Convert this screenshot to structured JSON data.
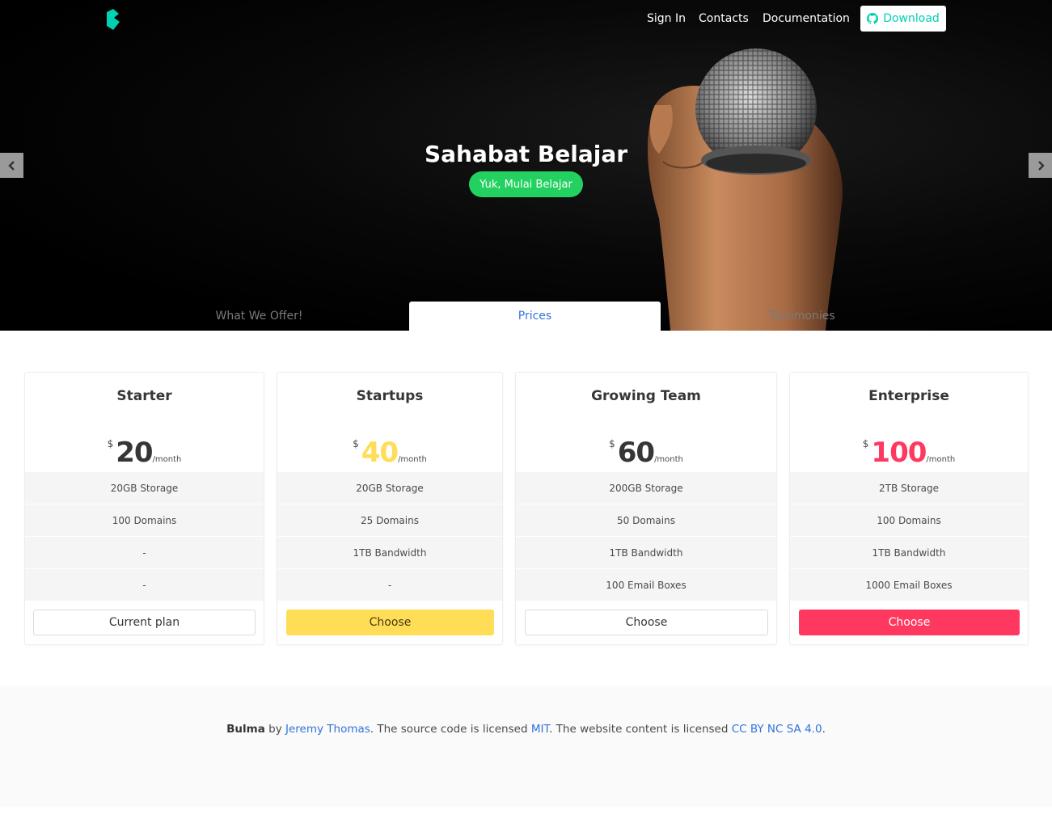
{
  "nav": {
    "items": [
      "Sign In",
      "Contacts",
      "Documentation"
    ],
    "download_label": "Download"
  },
  "hero": {
    "title": "Sahabat Belajar",
    "cta": "Yuk, Mulai Belajar"
  },
  "tabs": [
    {
      "label": "What We Offer!",
      "active": false
    },
    {
      "label": "Prices",
      "active": true
    },
    {
      "label": "Testimonies",
      "active": false
    }
  ],
  "plans": [
    {
      "name": "Starter",
      "currency": "$",
      "price": "20",
      "period": "/month",
      "price_color": "#363636",
      "features": [
        "20GB Storage",
        "100 Domains",
        "-",
        "-"
      ],
      "button": "Current plan",
      "button_style": "outline"
    },
    {
      "name": "Startups",
      "currency": "$",
      "price": "40",
      "period": "/month",
      "price_color": "#ffdd57",
      "features": [
        "20GB Storage",
        "25 Domains",
        "1TB Bandwidth",
        "-"
      ],
      "button": "Choose",
      "button_style": "yellow"
    },
    {
      "name": "Growing Team",
      "currency": "$",
      "price": "60",
      "period": "/month",
      "price_color": "#363636",
      "features": [
        "200GB Storage",
        "50 Domains",
        "1TB Bandwidth",
        "100 Email Boxes"
      ],
      "button": "Choose",
      "button_style": "outline"
    },
    {
      "name": "Enterprise",
      "currency": "$",
      "price": "100",
      "period": "/month",
      "price_color": "#ff3860",
      "features": [
        "2TB Storage",
        "100 Domains",
        "1TB Bandwidth",
        "1000 Email Boxes"
      ],
      "button": "Choose",
      "button_style": "red"
    }
  ],
  "footer": {
    "brand": "Bulma",
    "by": " by ",
    "author": "Jeremy Thomas",
    "mid": ". The source code is licensed ",
    "license": "MIT",
    "mid2": ". The website content is licensed ",
    "content_license": "CC BY NC SA 4.0",
    "end": "."
  },
  "colors": {
    "accent": "#00d1b2",
    "success": "#23d160",
    "link": "#3273dc",
    "warning": "#ffdd57",
    "danger": "#ff3860"
  },
  "icons": [
    "bulma-logo-icon",
    "github-icon",
    "chevron-left-icon",
    "chevron-right-icon"
  ]
}
